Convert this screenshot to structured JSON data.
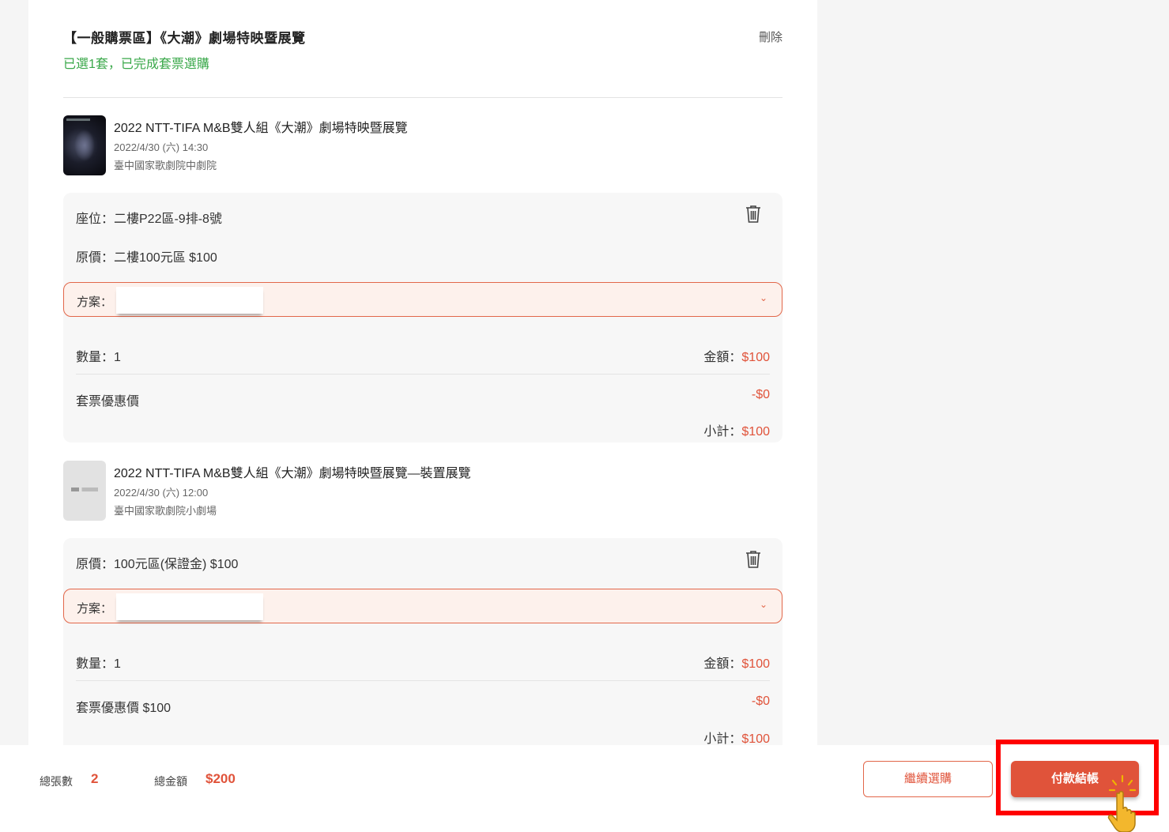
{
  "package": {
    "title": "【一般購票區】《大潮》劇場特映暨展覽",
    "status": "已選1套，已完成套票選購",
    "delete_label": "刪除"
  },
  "items": [
    {
      "event_title": "2022 NTT-TIFA M&B雙人組《大潮》劇場特映暨展覽",
      "date": "2022/4/30 (六) 14:30",
      "venue": "臺中國家歌劇院中劇院",
      "seat": "座位：二樓P22區-9排-8號",
      "price": "原價：二樓100元區 $100",
      "plan_label": "方案：",
      "quantity": "數量：1",
      "amount_label": "金額：",
      "amount_value": "$100",
      "discount_label": "套票優惠價",
      "discount_value": "-$0",
      "subtotal_label": "小計：",
      "subtotal_value": "$100"
    },
    {
      "event_title": "2022 NTT-TIFA M&B雙人組《大潮》劇場特映暨展覽—裝置展覽",
      "date": "2022/4/30 (六) 12:00",
      "venue": "臺中國家歌劇院小劇場",
      "price": "原價：100元區(保證金) $100",
      "plan_label": "方案：",
      "quantity": "數量：1",
      "amount_label": "金額：",
      "amount_value": "$100",
      "discount_label": "套票優惠價 $100",
      "discount_value": "-$0",
      "subtotal_label": "小計：",
      "subtotal_value": "$100"
    }
  ],
  "footer": {
    "total_count_label": "總張數",
    "total_count": "2",
    "total_amount_label": "總金額",
    "total_amount": "$200",
    "continue_label": "繼續選購",
    "checkout_label": "付款結帳"
  },
  "colors": {
    "accent": "#e0533a",
    "success": "#3aa84a",
    "highlight": "#ff0000"
  }
}
